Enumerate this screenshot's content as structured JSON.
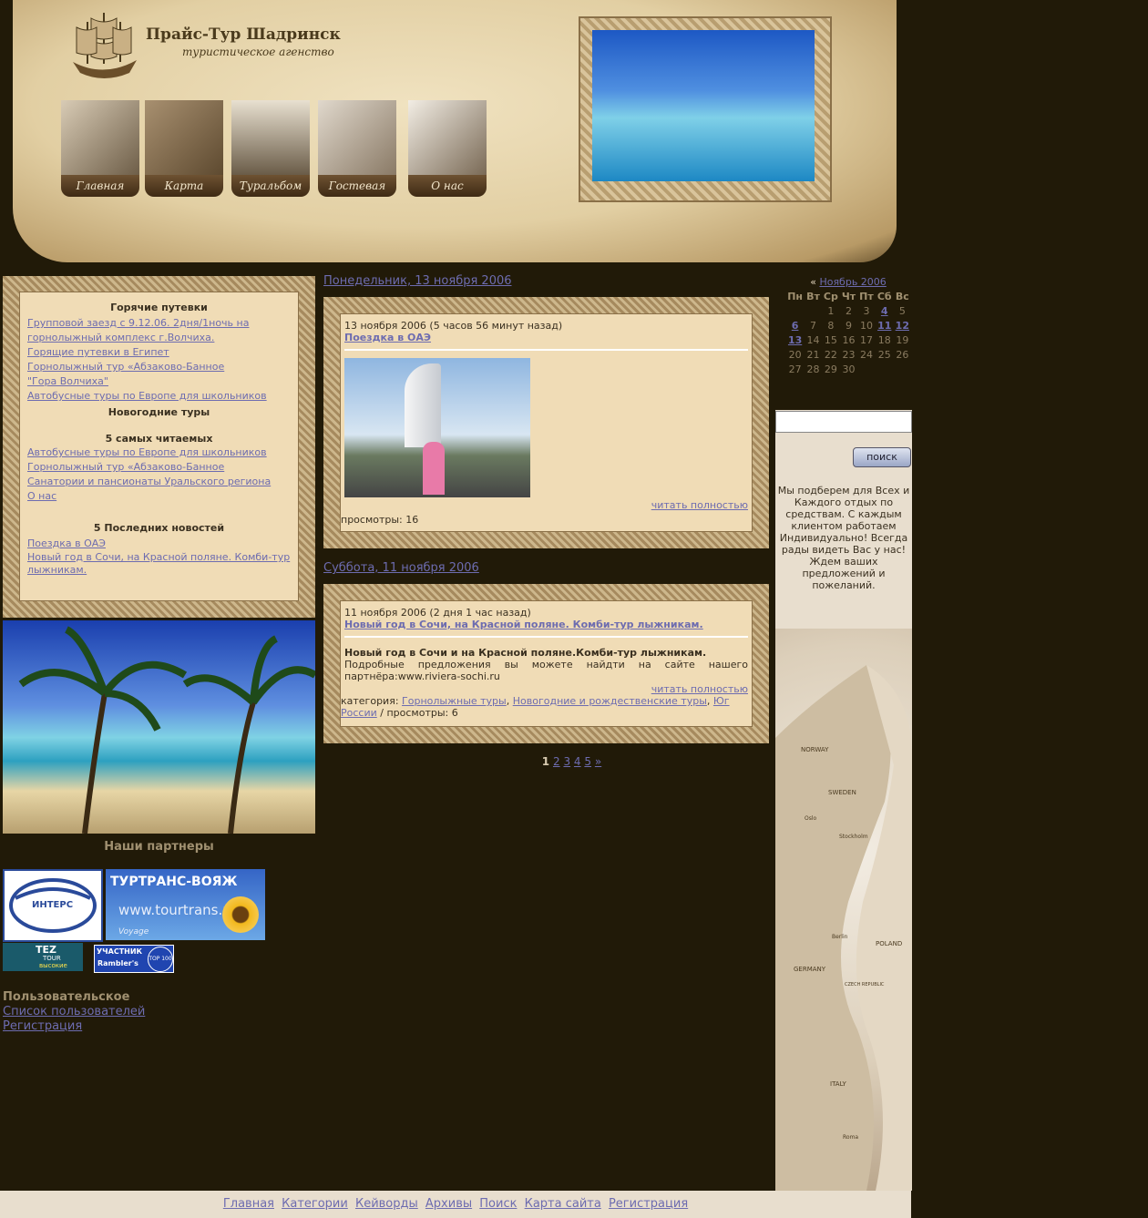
{
  "header": {
    "site_title": "Прайс-Тур Шадринск",
    "slogan": "туристическое агенство",
    "nav": [
      {
        "label": "Главная"
      },
      {
        "label": "Карта"
      },
      {
        "label": "Туральбом"
      },
      {
        "label": "Гостевая"
      },
      {
        "label": "О нас"
      }
    ]
  },
  "left": {
    "hot_title": "Горячие путевки",
    "hot_links": [
      "Групповой заезд с 9.12.06. 2дня/1ночь на горнолыжный комплекс г.Волчиха.",
      "Горящие путевки в Египет",
      "Горнолыжный тур «Абзаково-Банное",
      "\"Гора Волчиха\"",
      "Автобусные туры по Европе для школьников"
    ],
    "newyear_title": "Новогодние туры",
    "top_title": "5 самых читаемых",
    "top_links": [
      "Автобусные туры по Европе для школьников",
      "Горнолыжный тур «Абзаково-Банное",
      "Санатории и пансионаты Уральского региона",
      "О нас"
    ],
    "last_title": "5 Последних новостей",
    "last_links": [
      "Поездка в ОАЭ",
      "Новый год в Сочи, на Красной поляне. Комби-тур лыжникам."
    ],
    "partners_title": "Наши партнеры",
    "partner_intres": "ИНТЕРС",
    "partner_tourtrans_name": "ТУРТРАНС-ВОЯЖ",
    "partner_tourtrans_url": "www.tourtrans.ru",
    "partner_tourtrans_tag": "Voyage",
    "partner_tez": "TEZ",
    "partner_tez_tour": "TOUR",
    "partner_tez_sub": "высокие",
    "partner_rambler_1": "УЧАСТНИК",
    "partner_rambler_2": "Rambler's",
    "partner_rambler_top": "TOP 100",
    "user_title": "Пользовательское",
    "user_links": [
      "Список пользователей",
      "Регистрация"
    ]
  },
  "center": {
    "date1": "Понедельник, 13 ноября 2006",
    "post1_meta": "13 ноября 2006 (5 часов 56 минут назад)",
    "post1_title": "Поездка в ОАЭ",
    "post1_more": "читать полностью",
    "post1_views": "просмотры: 16",
    "date2": "Суббота, 11 ноября 2006",
    "post2_meta": "11 ноября 2006 (2 дня 1 час назад)",
    "post2_title": "Новый год в Сочи, на Красной поляне. Комби-тур лыжникам.",
    "post2_body_bold": "Новый год в Сочи и на Красной поляне.Комби-тур лыжникам.",
    "post2_body": "Подробные предложения вы можете найдти на сайте нашего партнёра:www.riviera-sochi.ru",
    "post2_more": "читать полностью",
    "post2_cat_label": "категория:",
    "post2_cats": [
      "Горнолыжные туры",
      "Новогодние и рождественские туры",
      "Юг России"
    ],
    "post2_views": "/ просмотры: 6",
    "pager_current": "1",
    "pager_pages": [
      "2",
      "3",
      "4",
      "5",
      "»"
    ]
  },
  "right": {
    "cal_prev": "«",
    "cal_month": "Ноябрь 2006",
    "cal_days": [
      "Пн",
      "Вт",
      "Ср",
      "Чт",
      "Пт",
      "Сб",
      "Вс"
    ],
    "cal_rows": [
      [
        "",
        "",
        "1",
        "2",
        "3",
        "4",
        "5"
      ],
      [
        "6",
        "7",
        "8",
        "9",
        "10",
        "11",
        "12"
      ],
      [
        "13",
        "14",
        "15",
        "16",
        "17",
        "18",
        "19"
      ],
      [
        "20",
        "21",
        "22",
        "23",
        "24",
        "25",
        "26"
      ],
      [
        "27",
        "28",
        "29",
        "30",
        "",
        "",
        ""
      ]
    ],
    "cal_linked": [
      "4",
      "6",
      "11",
      "12",
      "13"
    ],
    "search_button": "поиск",
    "search_value": "",
    "welcome": "Мы подберем для Всех и Каждого отдых по средствам. С каждым клиентом работаем Индивидуально! Всегда рады видеть Вас у нас! Ждем ваших предложений и пожеланий.",
    "map_labels": [
      "NORWAY",
      "SWEDEN",
      "Stockholm",
      "Oslo",
      "Berlin",
      "POLAND",
      "GERMANY",
      "CZECH REPUBLIC",
      "ITALY",
      "Roma"
    ]
  },
  "footer": {
    "links": [
      "Главная",
      "Категории",
      "Кейворды",
      "Архивы",
      "Поиск",
      "Карта сайта",
      "Регистрация"
    ]
  }
}
